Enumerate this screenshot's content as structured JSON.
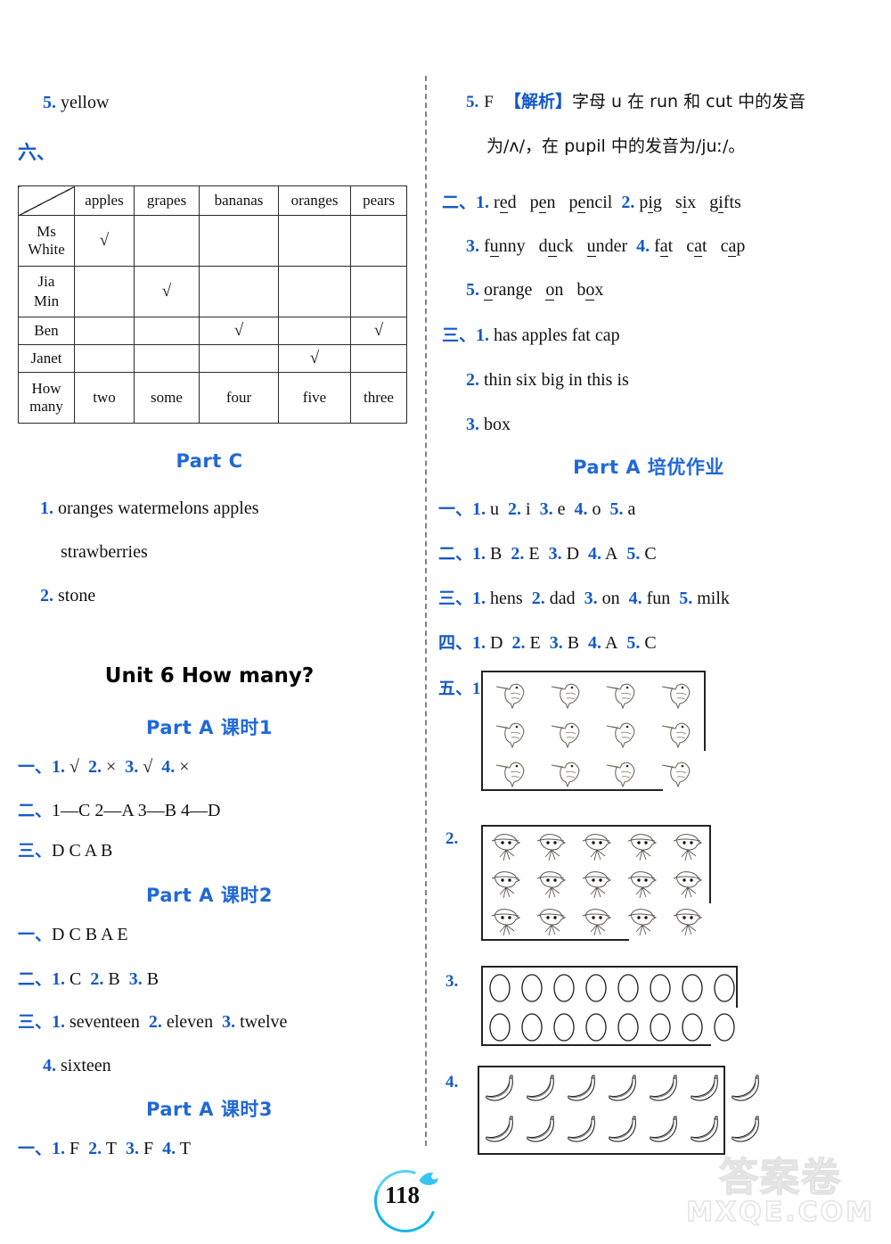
{
  "page": {
    "number": "118",
    "watermark_cn": "答案卷",
    "watermark_en": "MXQE.COM"
  },
  "left_column": {
    "item5_label": "5.",
    "item5_text": "yellow",
    "section_six_label": "六、",
    "table": {
      "columns": [
        "apples",
        "grapes",
        "bananas",
        "oranges",
        "pears"
      ],
      "rows": [
        {
          "name": "Ms White",
          "checks": [
            true,
            false,
            false,
            false,
            false
          ]
        },
        {
          "name": "Jia Min",
          "checks": [
            false,
            true,
            false,
            false,
            false
          ]
        },
        {
          "name": "Ben",
          "checks": [
            false,
            false,
            true,
            false,
            true
          ]
        },
        {
          "name": "Janet",
          "checks": [
            false,
            false,
            false,
            true,
            false
          ]
        }
      ],
      "howmany_label": "How many",
      "howmany_values": [
        "two",
        "some",
        "four",
        "five",
        "three"
      ],
      "check_glyph": "√"
    },
    "part_c_title": "Part C",
    "part_c_items": [
      {
        "num": "1.",
        "text": "oranges    watermelons    apples"
      },
      {
        "num": "",
        "text": "strawberries"
      },
      {
        "num": "2.",
        "text": "stone"
      }
    ],
    "unit_title": "Unit 6    How many?",
    "part_a1_title": "Part A    课时1",
    "part_a1_lines": [
      {
        "cn": "一、",
        "items": [
          {
            "n": "1.",
            "a": "√"
          },
          {
            "n": "2.",
            "a": "×"
          },
          {
            "n": "3.",
            "a": "√"
          },
          {
            "n": "4.",
            "a": "×"
          }
        ]
      },
      {
        "cn": "二、",
        "plain": "1—C   2—A   3—B   4—D"
      },
      {
        "cn": "三、",
        "plain": "D   C   A   B"
      }
    ],
    "part_a2_title": "Part A    课时2",
    "part_a2_lines": [
      {
        "cn": "一、",
        "plain": "D   C   B   A   E"
      },
      {
        "cn": "二、",
        "items": [
          {
            "n": "1.",
            "a": "C"
          },
          {
            "n": "2.",
            "a": "B"
          },
          {
            "n": "3.",
            "a": "B"
          }
        ]
      },
      {
        "cn": "三、",
        "items": [
          {
            "n": "1.",
            "a": "seventeen"
          },
          {
            "n": "2.",
            "a": "eleven"
          },
          {
            "n": "3.",
            "a": "twelve"
          }
        ]
      },
      {
        "cn": "",
        "items": [
          {
            "n": "4.",
            "a": "sixteen"
          }
        ]
      }
    ],
    "part_a3_title": "Part A    课时3",
    "part_a3_lines": [
      {
        "cn": "一、",
        "items": [
          {
            "n": "1.",
            "a": "F"
          },
          {
            "n": "2.",
            "a": "T"
          },
          {
            "n": "3.",
            "a": "F"
          },
          {
            "n": "4.",
            "a": "T"
          }
        ]
      }
    ]
  },
  "right_column": {
    "item5_label": "5.",
    "item5_answer": "F",
    "analysis_tag": "【解析】",
    "analysis_line1": "字母 u 在 run 和 cut 中的发音",
    "analysis_line2": "为/ʌ/，在 pupil 中的发音为/juː/。",
    "section_two_label": "二、",
    "section_two_rows": [
      {
        "items": [
          {
            "n": "1.",
            "words": [
              {
                "pre": "r",
                "u": "e",
                "post": "d"
              },
              {
                "pre": "p",
                "u": "e",
                "post": "n"
              },
              {
                "pre": "p",
                "u": "e",
                "post": "ncil"
              }
            ]
          },
          {
            "n": "2.",
            "words": [
              {
                "pre": "p",
                "u": "i",
                "post": "g"
              },
              {
                "pre": "s",
                "u": "i",
                "post": "x"
              },
              {
                "pre": "g",
                "u": "i",
                "post": "fts"
              }
            ]
          }
        ]
      },
      {
        "items": [
          {
            "n": "3.",
            "words": [
              {
                "pre": "f",
                "u": "u",
                "post": "nny"
              },
              {
                "pre": "d",
                "u": "u",
                "post": "ck"
              },
              {
                "pre": "",
                "u": "u",
                "post": "nder"
              }
            ]
          },
          {
            "n": "4.",
            "words": [
              {
                "pre": "f",
                "u": "a",
                "post": "t"
              },
              {
                "pre": "c",
                "u": "a",
                "post": "t"
              },
              {
                "pre": "c",
                "u": "a",
                "post": "p"
              }
            ]
          }
        ]
      },
      {
        "items": [
          {
            "n": "5.",
            "words": [
              {
                "pre": "",
                "u": "o",
                "post": "range"
              },
              {
                "pre": "",
                "u": "o",
                "post": "n"
              },
              {
                "pre": "b",
                "u": "o",
                "post": "x"
              }
            ]
          }
        ]
      }
    ],
    "section_three_label": "三、",
    "section_three_rows": [
      {
        "n": "1.",
        "text": "has   apples   fat   cap"
      },
      {
        "n": "2.",
        "text": "thin   six   big   in   this   is"
      },
      {
        "n": "3.",
        "text": "box"
      }
    ],
    "part_a_peiyou_title": "Part A    培优作业",
    "peiyou_lines": [
      {
        "cn": "一、",
        "items": [
          {
            "n": "1.",
            "a": "u"
          },
          {
            "n": "2.",
            "a": "i"
          },
          {
            "n": "3.",
            "a": "e"
          },
          {
            "n": "4.",
            "a": "o"
          },
          {
            "n": "5.",
            "a": "a"
          }
        ]
      },
      {
        "cn": "二、",
        "items": [
          {
            "n": "1.",
            "a": "B"
          },
          {
            "n": "2.",
            "a": "E"
          },
          {
            "n": "3.",
            "a": "D"
          },
          {
            "n": "4.",
            "a": "A"
          },
          {
            "n": "5.",
            "a": "C"
          }
        ]
      },
      {
        "cn": "三、",
        "items": [
          {
            "n": "1.",
            "a": "hens"
          },
          {
            "n": "2.",
            "a": "dad"
          },
          {
            "n": "3.",
            "a": "on"
          },
          {
            "n": "4.",
            "a": "fun"
          },
          {
            "n": "5.",
            "a": "milk"
          }
        ]
      },
      {
        "cn": "四、",
        "items": [
          {
            "n": "1.",
            "a": "D"
          },
          {
            "n": "2.",
            "a": "E"
          },
          {
            "n": "3.",
            "a": "B"
          },
          {
            "n": "4.",
            "a": "A"
          },
          {
            "n": "5.",
            "a": "C"
          }
        ]
      }
    ],
    "section_five_label": "五、",
    "picture_answers": [
      {
        "num": "1.",
        "icon": "bird-icon",
        "cols": 4,
        "rows": 3,
        "total": 12,
        "circled": 11
      },
      {
        "num": "2.",
        "icon": "bird-with-hat-icon",
        "cols": 5,
        "rows": 3,
        "total": 15,
        "circled": 13
      },
      {
        "num": "3.",
        "icon": "egg-icon",
        "cols": 8,
        "rows": 2,
        "total": 16,
        "circled": 15
      },
      {
        "num": "4.",
        "icon": "banana-icon",
        "cols": 7,
        "rows": 2,
        "total": 14,
        "circled": 12
      }
    ]
  }
}
